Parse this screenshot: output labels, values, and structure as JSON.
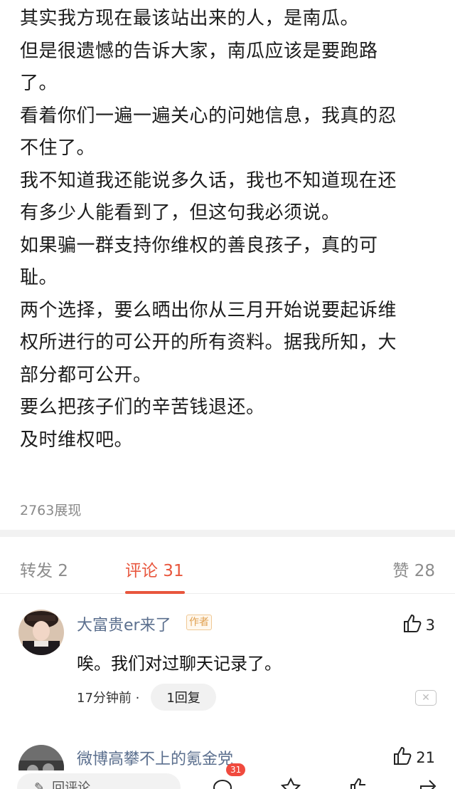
{
  "post": {
    "lines": [
      "其实我方现在最该站出来的人，是南瓜。",
      "但是很遗憾的告诉大家，南瓜应该是要跑路",
      "了。",
      "看着你们一遍一遍关心的问她信息，我真的忍",
      "不住了。",
      "我不知道我还能说多久话，我也不知道现在还",
      "有多少人能看到了，但这句我必须说。",
      "如果骗一群支持你维权的善良孩子，真的可",
      "耻。",
      "两个选择，要么晒出你从三月开始说要起诉维",
      "权所进行的可公开的所有资料。据我所知，大",
      "部分都可公开。",
      "要么把孩子们的辛苦钱退还。",
      "及时维权吧。"
    ],
    "views": "2763展现"
  },
  "tabs": {
    "repost": "转发 2",
    "comments": "评论 31",
    "likes": "赞 28"
  },
  "comments": [
    {
      "name": "大富贵er来了",
      "tag": "作者",
      "likes": "3",
      "text": "唉。我们对过聊天记录了。",
      "time": "17分钟前 ·",
      "reply": "1回复"
    },
    {
      "name": "微博高攀不上的氪金党",
      "likes": "21"
    }
  ],
  "bottom": {
    "compose": "回评论",
    "comment_badge": "31"
  },
  "colors": {
    "accent": "#e8563d",
    "username": "#5b6f8e",
    "muted": "#8a8a8a"
  }
}
